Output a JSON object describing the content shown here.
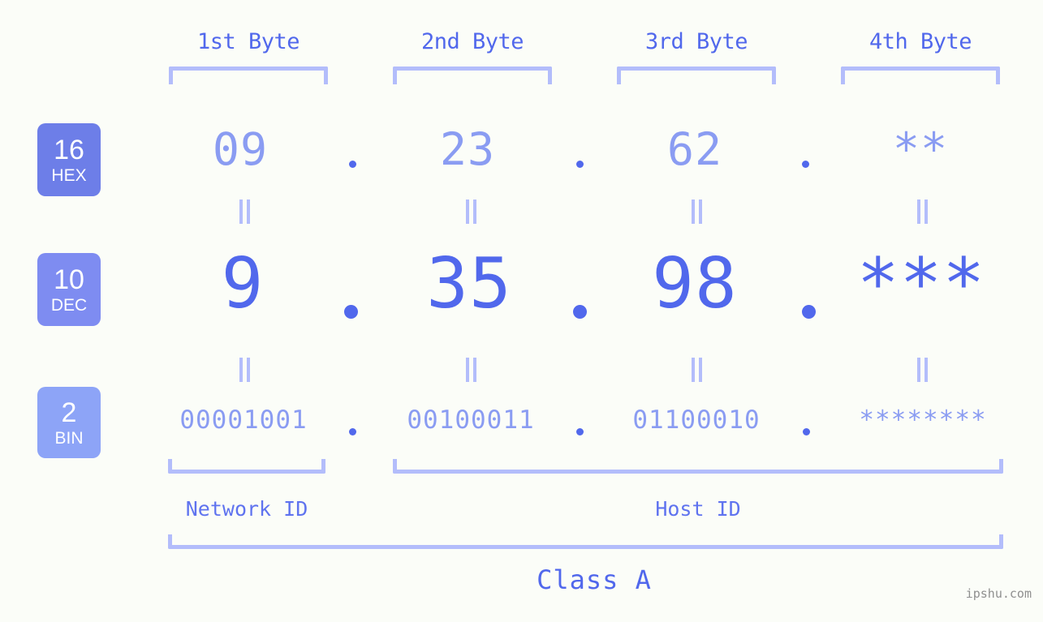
{
  "page": {
    "background_color": "#fbfdf8",
    "accent_strong": "#5168ec",
    "accent_light": "#8a9cf2",
    "bracket_color": "#b3bdfb",
    "watermark": "ipshu.com"
  },
  "header": {
    "byte_labels": [
      "1st Byte",
      "2nd Byte",
      "3rd Byte",
      "4th Byte"
    ]
  },
  "bases": [
    {
      "number": "16",
      "name": "HEX",
      "color": "#6d7ee8"
    },
    {
      "number": "10",
      "name": "DEC",
      "color": "#7e8cf1"
    },
    {
      "number": "2",
      "name": "BIN",
      "color": "#8da4f7"
    }
  ],
  "rows": {
    "hex": {
      "values": [
        "09",
        "23",
        "62",
        "**"
      ],
      "separator": "."
    },
    "dec": {
      "values": [
        "9",
        "35",
        "98",
        "***"
      ],
      "separator": "."
    },
    "bin": {
      "values": [
        "00001001",
        "00100011",
        "01100010",
        "********"
      ],
      "separator": "."
    }
  },
  "equality_symbol": "=",
  "footer": {
    "network_id_label": "Network ID",
    "host_id_label": "Host ID",
    "class_label": "Class A"
  }
}
